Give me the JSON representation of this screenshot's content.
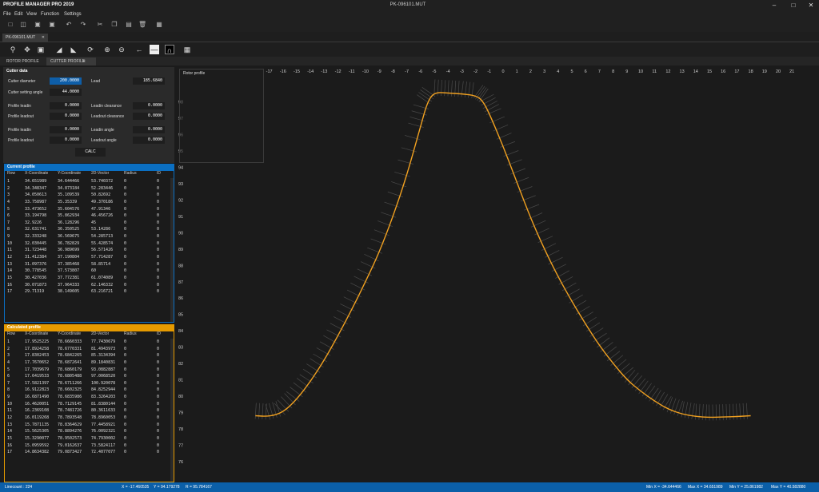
{
  "app": {
    "title": "PROFILE MANAGER PRO 2019",
    "file_title": "PK-096101.MUT",
    "accent": "#0b6fc2",
    "calc_color": "#f0a000",
    "curve_color": "#f0a020"
  },
  "menu": [
    "File",
    "Edit",
    "View",
    "Function",
    "Settings"
  ],
  "toolbar_icons": [
    "new-icon",
    "open-icon",
    "save-icon",
    "save-as-icon",
    "undo-icon",
    "redo-icon",
    "cut-icon",
    "copy-icon",
    "paste-icon",
    "delete-icon",
    "calculator-icon"
  ],
  "toolbar2_icons": [
    "zoom-icon",
    "pan-icon",
    "fit-icon",
    "mirror-left-icon",
    "mirror-right-icon",
    "refresh-icon",
    "zoom-in-icon",
    "zoom-out-icon",
    "arrow-left-icon",
    "line-mode-icon",
    "profile-mode-icon",
    "grid-icon"
  ],
  "doc_tab": "PK-096101.MUT",
  "sub_tabs": [
    "ROTOR PROFILE",
    "CUTTER PROFILE"
  ],
  "cutter": {
    "header": "Cutter data",
    "diameter_label": "Cutter diameter",
    "diameter": "200.0000",
    "lead_label": "Lead",
    "lead": "185.6840",
    "angle_label": "Cutter setting angle",
    "angle": "44.0000",
    "profile_leadin_label": "Profile leadin",
    "profile_leadin": "0.0000",
    "leadin_clearance_label": "Leadin clearance",
    "leadin_clearance": "0.0000",
    "profile_leadout_label": "Profile leadout",
    "profile_leadout": "0.0000",
    "leadout_clearance_label": "Leadout clearance",
    "leadout_clearance": "0.0000",
    "profile_leadin2_label": "Profile leadin",
    "profile_leadin2": "0.0000",
    "leadin_angle_label": "Leadin angle",
    "leadin_angle": "0.0000",
    "profile_leadout2_label": "Profile leadout",
    "profile_leadout2": "0.0000",
    "leadout_angle_label": "Leadout angle",
    "leadout_angle": "0.0000",
    "calc_label": "CALC"
  },
  "current_profile": {
    "header": "Current profile",
    "columns": [
      "Row",
      "X-Coordinate",
      "Y-Coordinate",
      "2D-Vector",
      "Radius",
      "ID"
    ],
    "rows": [
      [
        "1",
        "34.651989",
        "34.644466",
        "53.740372",
        "0",
        "0"
      ],
      [
        "2",
        "34.348347",
        "34.873184",
        "52.283446",
        "0",
        "0"
      ],
      [
        "3",
        "34.050613",
        "35.109539",
        "50.82692",
        "0",
        "0"
      ],
      [
        "4",
        "33.758987",
        "35.35339",
        "49.370186",
        "0",
        "0"
      ],
      [
        "5",
        "33.473652",
        "35.604576",
        "47.91346",
        "0",
        "0"
      ],
      [
        "6",
        "33.194798",
        "35.862934",
        "46.456726",
        "0",
        "0"
      ],
      [
        "7",
        "32.9226",
        "36.128296",
        "45",
        "0",
        "0"
      ],
      [
        "8",
        "32.631741",
        "36.350525",
        "53.14286",
        "0",
        "0"
      ],
      [
        "9",
        "32.333248",
        "36.569675",
        "54.285713",
        "0",
        "0"
      ],
      [
        "10",
        "32.030445",
        "36.782829",
        "55.428574",
        "0",
        "0"
      ],
      [
        "11",
        "31.723448",
        "36.989699",
        "56.571426",
        "0",
        "0"
      ],
      [
        "12",
        "31.412384",
        "37.190804",
        "57.714287",
        "0",
        "0"
      ],
      [
        "13",
        "31.097376",
        "37.385468",
        "58.85714",
        "0",
        "0"
      ],
      [
        "14",
        "30.778545",
        "37.573807",
        "60",
        "0",
        "0"
      ],
      [
        "15",
        "30.427036",
        "37.772381",
        "61.074089",
        "0",
        "0"
      ],
      [
        "16",
        "30.071873",
        "37.964333",
        "62.146332",
        "0",
        "0"
      ],
      [
        "17",
        "29.71319",
        "38.149605",
        "63.216721",
        "0",
        "0"
      ]
    ]
  },
  "calculated_profile": {
    "header": "Calculated profile",
    "columns": [
      "Row",
      "X-Coordinate",
      "Y-Coordinate",
      "2D-Vector",
      "Radius",
      "ID"
    ],
    "rows": [
      [
        "1",
        "17.9525225",
        "78.6660333",
        "77.7430679",
        "0",
        "0"
      ],
      [
        "2",
        "17.8924258",
        "78.6770331",
        "81.4943973",
        "0",
        "0"
      ],
      [
        "3",
        "17.8302453",
        "78.6842265",
        "85.3134394",
        "0",
        "0"
      ],
      [
        "4",
        "17.7670652",
        "78.6872641",
        "89.1840831",
        "0",
        "0"
      ],
      [
        "5",
        "17.7039679",
        "78.6860179",
        "93.0882887",
        "0",
        "0"
      ],
      [
        "6",
        "17.6419533",
        "78.6805488",
        "97.0068520",
        "0",
        "0"
      ],
      [
        "7",
        "17.5821397",
        "78.6711266",
        "100.920078",
        "0",
        "0"
      ],
      [
        "8",
        "16.9122823",
        "78.6602325",
        "84.8252944",
        "0",
        "0"
      ],
      [
        "9",
        "16.6871490",
        "78.6835986",
        "83.3264203",
        "0",
        "0"
      ],
      [
        "10",
        "16.4620051",
        "78.7129145",
        "81.8380144",
        "0",
        "0"
      ],
      [
        "11",
        "16.2369108",
        "78.7481726",
        "80.3611633",
        "0",
        "0"
      ],
      [
        "12",
        "16.0119268",
        "78.7893548",
        "78.8960053",
        "0",
        "0"
      ],
      [
        "13",
        "15.7871135",
        "78.8364629",
        "77.4458921",
        "0",
        "0"
      ],
      [
        "14",
        "15.5625305",
        "78.8894276",
        "76.0092321",
        "0",
        "0"
      ],
      [
        "15",
        "15.3290077",
        "78.9502573",
        "74.7930002",
        "0",
        "0"
      ],
      [
        "16",
        "15.0959592",
        "79.0162637",
        "73.5824117",
        "0",
        "0"
      ],
      [
        "17",
        "14.8634382",
        "79.0873427",
        "72.4077077",
        "0",
        "0"
      ]
    ]
  },
  "plot": {
    "overlay_title": "Rotor profile",
    "x_ticks": [
      -17,
      -16,
      -15,
      -14,
      -13,
      -12,
      -11,
      -10,
      -9,
      -8,
      -7,
      -6,
      -5,
      -4,
      -3,
      -2,
      -1,
      0,
      1,
      2,
      3,
      4,
      5,
      6,
      7,
      8,
      9,
      10,
      11,
      12,
      13,
      14,
      15,
      16,
      17,
      18,
      19,
      20,
      21
    ],
    "y_ticks": [
      76,
      77,
      78,
      79,
      80,
      81,
      82,
      83,
      84,
      85,
      86,
      87,
      88,
      89,
      90,
      91,
      92,
      93,
      94,
      95,
      96,
      97,
      98
    ]
  },
  "chart_data": {
    "type": "line",
    "series": [
      {
        "x": [
          -18,
          -17,
          -16,
          -15,
          -14,
          -13,
          -12,
          -11,
          -10,
          -9,
          -8,
          -7,
          -6,
          -5.5,
          -5,
          -4,
          -3,
          -2,
          -1.5,
          -1,
          0,
          1,
          2,
          3,
          4,
          5,
          6,
          7,
          8,
          9,
          10,
          11,
          12,
          13,
          14,
          15,
          16,
          17,
          18
        ],
        "y": [
          78.8,
          78.75,
          79.0,
          79.8,
          80.9,
          82.2,
          83.7,
          85.3,
          87.0,
          88.8,
          91.0,
          93.5,
          96.5,
          98.0,
          98.6,
          98.55,
          98.5,
          98.4,
          98.1,
          97.3,
          95.3,
          93.1,
          90.9,
          89.0,
          87.3,
          85.8,
          84.4,
          83.1,
          82.0,
          81.0,
          80.3,
          79.7,
          79.2,
          78.9,
          78.75,
          78.7,
          78.72,
          78.75,
          78.8
        ]
      }
    ],
    "xlim": [
      -18,
      22
    ],
    "ylim": [
      75.5,
      99.6
    ],
    "grid": false
  },
  "status": {
    "linecount": "Linecount : 224",
    "x": "X = -17.460535",
    "y": "Y = 94.179278",
    "r": "R = 95.784167",
    "min_x": "Min X = -34.644466",
    "max_x": "Max X = 34.651989",
    "min_y": "Min Y = 25.861982",
    "max_y": "Max Y = 40.582880"
  }
}
